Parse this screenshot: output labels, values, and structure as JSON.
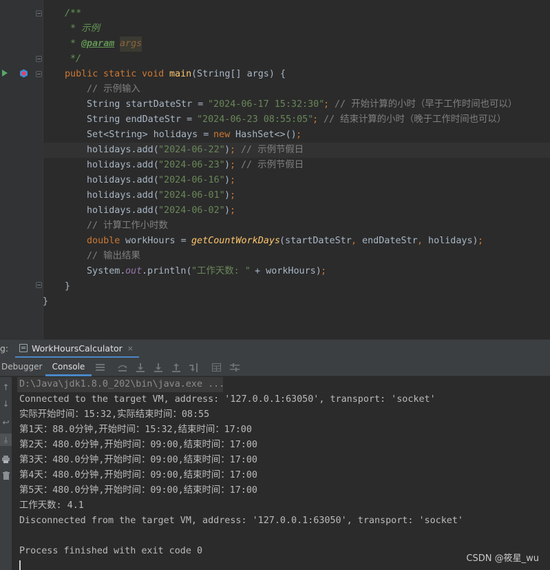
{
  "editor": {
    "code": {
      "doc_open": "/**",
      "doc_example": "* 示例",
      "doc_param_tag": "@param",
      "doc_param_name": "args",
      "doc_close": "*/",
      "main_public": "public",
      "main_static": "static",
      "main_void": "void",
      "main_name": "main",
      "main_params": "(String[] args) {",
      "c_example_input": "// 示例输入",
      "start_decl": "String startDateStr = ",
      "start_value": "\"2024-06-17 15:32:30\"",
      "start_semi": ";",
      "start_comment": "// 开始计算的小时（早于工作时间也可以）",
      "end_decl": "String endDateStr = ",
      "end_value": "\"2024-06-23 08:55:05\"",
      "end_semi": ";",
      "end_comment": "// 结束计算的小时（晚于工作时间也可以）",
      "set_decl": "Set<String> holidays = ",
      "set_new": "new",
      "set_ctor": " HashSet<>()",
      "set_semi": ";",
      "add_call": "holidays.add(",
      "add_close": ")",
      "semi": ";",
      "holiday_values": [
        "\"2024-06-22\"",
        "\"2024-06-23\"",
        "\"2024-06-16\"",
        "\"2024-06-01\"",
        "\"2024-06-02\""
      ],
      "holiday_comment": "// 示例节假日",
      "c_calc_hours": "// 计算工作小时数",
      "calc_type": "double",
      "calc_var": " workHours = ",
      "calc_fn": "getCountWorkDays",
      "calc_args_open": "(startDateStr",
      "comma": ",",
      "calc_arg2": " endDateStr",
      "calc_arg3": " holidays)",
      "c_output": "// 输出结果",
      "print_system": "System.",
      "print_out": "out",
      "print_rest": ".println(",
      "print_str": "\"工作天数: \"",
      "print_plus": " + workHours)",
      "close_method": "}",
      "close_class": "}"
    }
  },
  "toolwindow": {
    "debug_label": "g:",
    "run_tab_label": "WorkHoursCalculator",
    "run_tab_close": "×",
    "subtabs": {
      "debugger": "Debugger",
      "console": "Console"
    }
  },
  "console": {
    "command": "D:\\Java\\jdk1.8.0_202\\bin\\java.exe ...",
    "lines": [
      "Connected to the target VM, address: '127.0.0.1:63050', transport: 'socket'",
      "实际开始时间：15:32,实际结束时间：08:55",
      "第1天：88.0分钟,开始时间：15:32,结束时间：17:00",
      "第2天：480.0分钟,开始时间：09:00,结束时间：17:00",
      "第3天：480.0分钟,开始时间：09:00,结束时间：17:00",
      "第4天：480.0分钟,开始时间：09:00,结束时间：17:00",
      "第5天：480.0分钟,开始时间：09:00,结束时间：17:00",
      "工作天数: 4.1",
      "Disconnected from the target VM, address: '127.0.0.1:63050', transport: 'socket'",
      "",
      "Process finished with exit code 0"
    ]
  },
  "watermark": "CSDN @筱星_wu",
  "icons": {
    "gutter": [
      "run-icon",
      "debug-icon"
    ],
    "toolbar": [
      "lines-icon",
      "step-over-icon",
      "step-into-icon",
      "force-step-into-icon",
      "step-out-icon",
      "run-to-cursor-icon",
      "table-icon",
      "filter-icon"
    ],
    "left_strip": [
      "up-arrow-icon",
      "down-arrow-icon",
      "soft-wrap-icon",
      "scroll-end-icon",
      "print-icon",
      "trash-icon"
    ]
  },
  "colors": {
    "editor_bg": "#2b2b2b",
    "keyword": "#cc7832",
    "string": "#6a8759",
    "function": "#ffc66d",
    "doc_comment": "#629755",
    "line_comment": "#808080",
    "field": "#9876aa",
    "accent": "#4a88c7"
  }
}
